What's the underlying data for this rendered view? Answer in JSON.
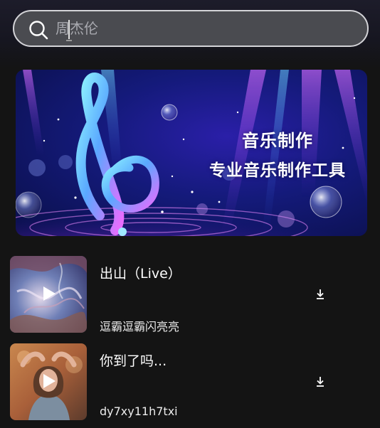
{
  "search": {
    "placeholder": "周杰伦",
    "icon": "search-icon"
  },
  "banner": {
    "title": "音乐制作",
    "subtitle": "专业音乐制作工具"
  },
  "songs": [
    {
      "title": "出山（Live）",
      "artist": "逗霸逗霸闪亮亮",
      "cover_icon": "play-icon",
      "action_icon": "download-icon"
    },
    {
      "title": "你到了吗...",
      "artist": "dy7xy11h7txi",
      "cover_icon": "play-icon",
      "action_icon": "download-icon"
    }
  ],
  "colors": {
    "background": "#141414",
    "search_bg": "#4a4b50",
    "search_border": "#d4d4d8",
    "banner_primary": "#141a7a",
    "banner_accent": "#c04cf0"
  }
}
